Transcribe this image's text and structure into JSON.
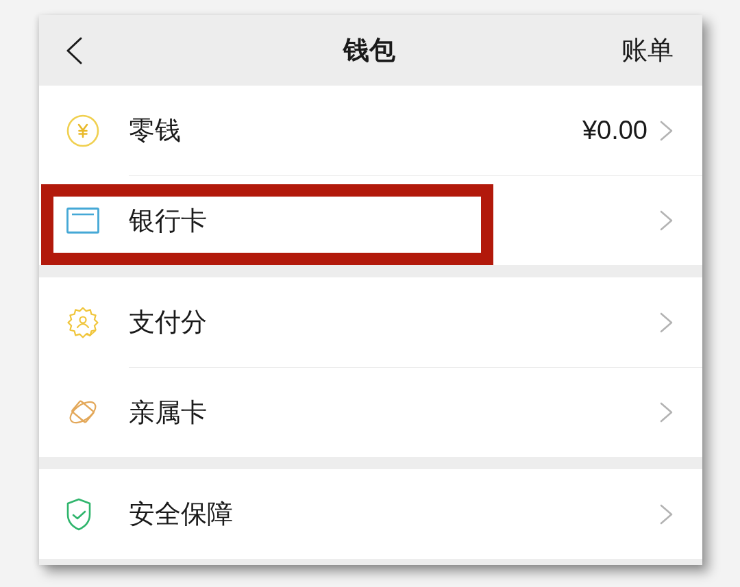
{
  "header": {
    "title": "钱包",
    "action": "账单"
  },
  "groups": [
    {
      "items": [
        {
          "kind": "balance",
          "label": "零钱",
          "value": "¥0.00",
          "highlighted": false
        },
        {
          "kind": "bankcard",
          "label": "银行卡",
          "highlighted": true
        }
      ]
    },
    {
      "items": [
        {
          "kind": "score",
          "label": "支付分",
          "highlighted": false
        },
        {
          "kind": "family",
          "label": "亲属卡",
          "highlighted": false
        }
      ]
    },
    {
      "items": [
        {
          "kind": "security",
          "label": "安全保障",
          "highlighted": false
        }
      ]
    }
  ]
}
